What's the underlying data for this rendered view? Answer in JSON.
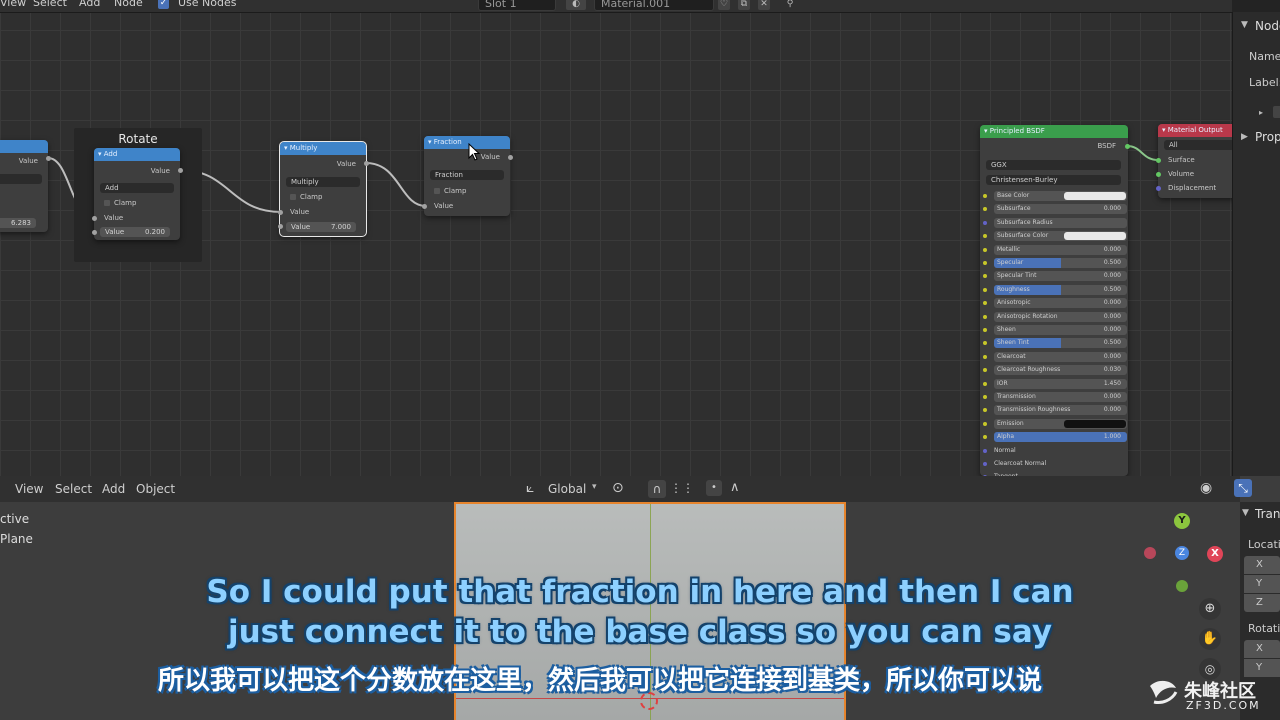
{
  "node_editor": {
    "menu": [
      "View",
      "Select",
      "Add",
      "Node"
    ],
    "use_nodes_label": "Use Nodes",
    "slot": "Slot 1",
    "material": "Material.001",
    "frame_label": "Rotate",
    "node_value_a": {
      "row_value": "Value",
      "field": "6.283"
    },
    "add_node": {
      "title": "Add",
      "output": "Value",
      "operation": "Add",
      "clamp": "Clamp",
      "input": "Value",
      "value_label": "Value",
      "value": "0.200"
    },
    "multiply_node": {
      "title": "Multiply",
      "output": "Value",
      "operation": "Multiply",
      "clamp": "Clamp",
      "input": "Value",
      "value_label": "Value",
      "value": "7.000"
    },
    "fraction_node": {
      "title": "Fraction",
      "output": "Value",
      "operation": "Fraction",
      "clamp": "Clamp",
      "input": "Value"
    },
    "principled": {
      "title": "Principled BSDF",
      "output": "BSDF",
      "distribution": "GGX",
      "subsurface_method": "Christensen-Burley",
      "rows": [
        {
          "label": "Base Color",
          "value": ""
        },
        {
          "label": "Subsurface",
          "value": "0.000"
        },
        {
          "label": "Subsurface Radius",
          "value": ""
        },
        {
          "label": "Subsurface Color",
          "value": ""
        },
        {
          "label": "Metallic",
          "value": "0.000"
        },
        {
          "label": "Specular",
          "value": "0.500"
        },
        {
          "label": "Specular Tint",
          "value": "0.000"
        },
        {
          "label": "Roughness",
          "value": "0.500"
        },
        {
          "label": "Anisotropic",
          "value": "0.000"
        },
        {
          "label": "Anisotropic Rotation",
          "value": "0.000"
        },
        {
          "label": "Sheen",
          "value": "0.000"
        },
        {
          "label": "Sheen Tint",
          "value": "0.500"
        },
        {
          "label": "Clearcoat",
          "value": "0.000"
        },
        {
          "label": "Clearcoat Roughness",
          "value": "0.030"
        },
        {
          "label": "IOR",
          "value": "1.450"
        },
        {
          "label": "Transmission",
          "value": "0.000"
        },
        {
          "label": "Transmission Roughness",
          "value": "0.000"
        },
        {
          "label": "Emission",
          "value": ""
        },
        {
          "label": "Alpha",
          "value": "1.000"
        },
        {
          "label": "Normal",
          "value": ""
        },
        {
          "label": "Clearcoat Normal",
          "value": ""
        },
        {
          "label": "Tangent",
          "value": ""
        }
      ]
    },
    "material_output": {
      "title": "Material Output",
      "target": "All",
      "inputs": [
        "Surface",
        "Volume",
        "Displacement"
      ]
    }
  },
  "sidebar": {
    "panel": "Node",
    "name_label": "Name:",
    "label_label": "Label:",
    "properties": "Properties"
  },
  "viewport": {
    "menu": [
      "View",
      "Select",
      "Add",
      "Object"
    ],
    "orientation": "Global",
    "info_line1": "ctive",
    "info_line2": "Plane",
    "right_panel": {
      "transform": "Transform",
      "location": "Location",
      "rotation": "Rotation",
      "axes": [
        "X",
        "Y",
        "Z"
      ]
    },
    "gizmo": {
      "x": "X",
      "y": "Y",
      "z": "Z"
    }
  },
  "subtitles": {
    "en_line1": "So I could put that fraction in here and then I can",
    "en_line2": "just connect it to the base class so you can say",
    "zh": "所以我可以把这个分数放在这里，然后我可以把它连接到基类，所以你可以说"
  },
  "watermark": {
    "name": "朱峰社区",
    "url": "ZF3D.COM"
  },
  "colors": {
    "node_header_math": "#3f84c9",
    "node_header_shader": "#3a9e4c",
    "node_header_output": "#b8384a",
    "selection": "#e6842c"
  }
}
